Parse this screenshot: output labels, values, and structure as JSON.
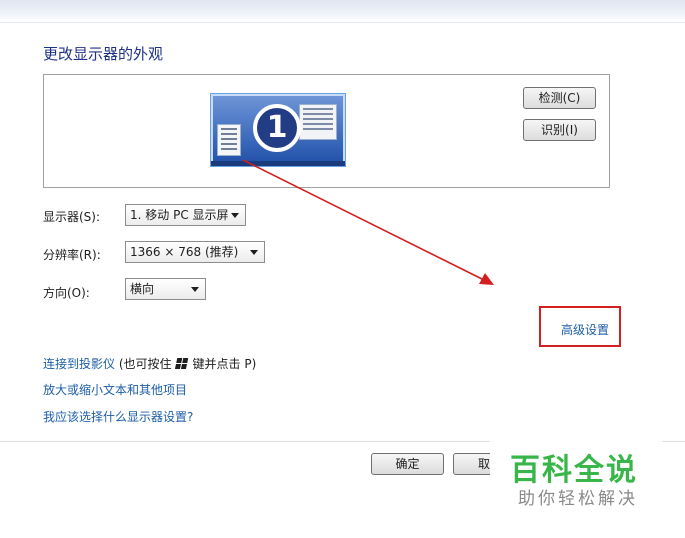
{
  "page": {
    "title": "更改显示器的外观"
  },
  "preview": {
    "monitor_number": "1",
    "detect_label": "检测(C)",
    "identify_label": "识别(I)"
  },
  "settings": {
    "display_label": "显示器(S):",
    "display_value": "1. 移动 PC 显示屏",
    "resolution_label": "分辨率(R):",
    "resolution_value": "1366 × 768 (推荐)",
    "orientation_label": "方向(O):",
    "orientation_value": "横向",
    "advanced_link": "高级设置"
  },
  "links": {
    "projector_prefix": "连接到投影仪",
    "projector_hint_a": " (也可按住",
    "projector_hint_b": "键并点击 P)",
    "text_size": "放大或缩小文本和其他项目",
    "which_settings": "我应该选择什么显示器设置?"
  },
  "footer": {
    "ok_label": "确定",
    "cancel_label": "取"
  },
  "watermark": {
    "title": "百科全说",
    "subtitle": "助你轻松解决"
  },
  "colors": {
    "link": "#1d5ea8",
    "title": "#1e3287",
    "annotation_red": "#d31f1f",
    "watermark_green": "#38b64a"
  }
}
